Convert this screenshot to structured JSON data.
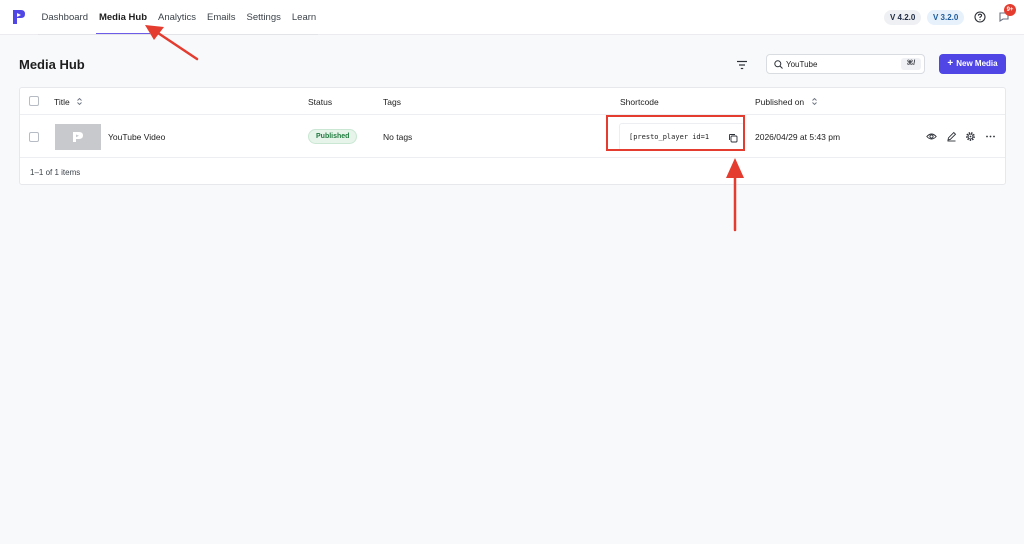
{
  "nav": {
    "items": [
      "Dashboard",
      "Media Hub",
      "Analytics",
      "Emails",
      "Settings",
      "Learn"
    ],
    "active_index": 1
  },
  "versions": [
    "V 4.2.0",
    "V 3.2.0"
  ],
  "notifications": {
    "badge": "9+"
  },
  "page": {
    "title": "Media Hub"
  },
  "search": {
    "value": "YouTube",
    "shortcut": "⌘/"
  },
  "toolbar": {
    "new_media_label": "New Media",
    "new_media_icon": "+"
  },
  "table": {
    "headers": {
      "title": "Title",
      "status": "Status",
      "tags": "Tags",
      "shortcode": "Shortcode",
      "published": "Published on"
    },
    "rows": [
      {
        "title": "YouTube Video",
        "status": "Published",
        "tags": "No tags",
        "shortcode": "[presto_player id=1",
        "published": "2026/04/29 at 5:43 pm"
      }
    ],
    "footer": "1–1 of 1 items"
  },
  "colors": {
    "accent": "#4f46e5",
    "annotation": "#e43c2f",
    "published_text": "#1f7a3d"
  },
  "icons": {
    "logo": "presto-logo-icon",
    "help": "help-icon",
    "notification": "bell-icon",
    "filter": "filter-icon",
    "search": "search-icon",
    "copy": "copy-icon",
    "row_actions": [
      "eye-icon",
      "pencil-icon",
      "gear-icon",
      "more-icon"
    ]
  }
}
